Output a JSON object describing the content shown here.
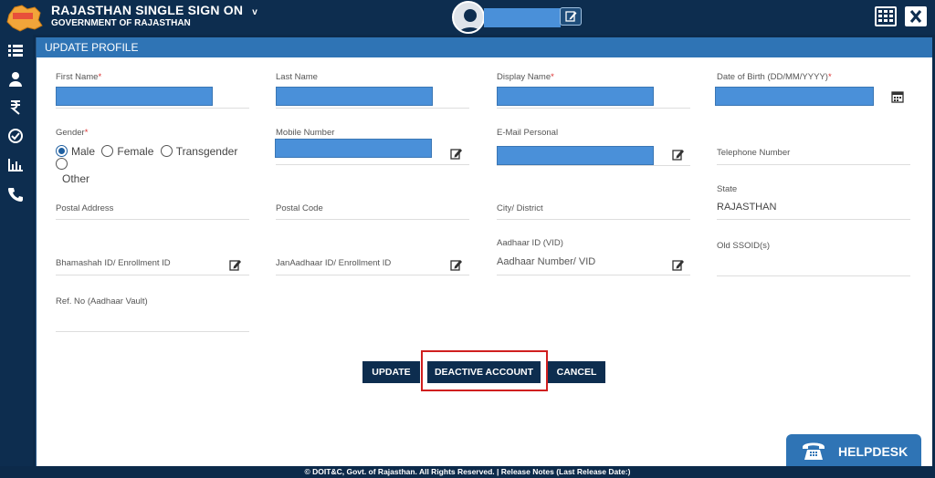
{
  "header": {
    "title": "RAJASTHAN SINGLE SIGN ON",
    "title_caret": "v",
    "subtitle": "GOVERNMENT OF RAJASTHAN"
  },
  "panel": {
    "title": "UPDATE PROFILE"
  },
  "fields": {
    "first_name": "First Name",
    "last_name": "Last Name",
    "display_name": "Display Name",
    "dob": "Date of Birth (DD/MM/YYYY)",
    "gender": "Gender",
    "mobile": "Mobile Number",
    "email": "E-Mail Personal",
    "telephone": "Telephone Number",
    "postal_address": "Postal Address",
    "postal_code": "Postal Code",
    "city": "City/ District",
    "state": "State",
    "state_value": "RAJASTHAN",
    "bhamashah": "Bhamashah ID/ Enrollment ID",
    "janaadhaar": "JanAadhaar ID/ Enrollment ID",
    "aadhaar": "Aadhaar ID (VID)",
    "aadhaar_placeholder": "Aadhaar Number/ VID",
    "old_ssoid": "Old SSOID(s)",
    "ref_no": "Ref. No  (Aadhaar Vault)",
    "required_mark": "*"
  },
  "gender_options": [
    "Male",
    "Female",
    "Transgender",
    "Other"
  ],
  "gender_selected": "Male",
  "buttons": {
    "update": "UPDATE",
    "deactivate": "DEACTIVE ACCOUNT",
    "cancel": "CANCEL"
  },
  "helpdesk": {
    "label": "HELPDESK"
  },
  "footer": {
    "text": "© DOIT&C, Govt. of Rajasthan. All Rights Reserved.   |  Release Notes (Last Release Date:)"
  },
  "colors": {
    "brand_dark": "#0d2d4f",
    "accent_blue": "#2f74b5",
    "highlight_red": "#d01f1f",
    "redaction": "#4a90d9"
  },
  "icons": [
    "menu-icon",
    "user-icon",
    "rupee-icon",
    "check-circle-icon",
    "bar-chart-icon",
    "phone-icon",
    "edit-icon",
    "calendar-icon",
    "apps-grid-icon",
    "close-icon",
    "telephone-icon"
  ]
}
